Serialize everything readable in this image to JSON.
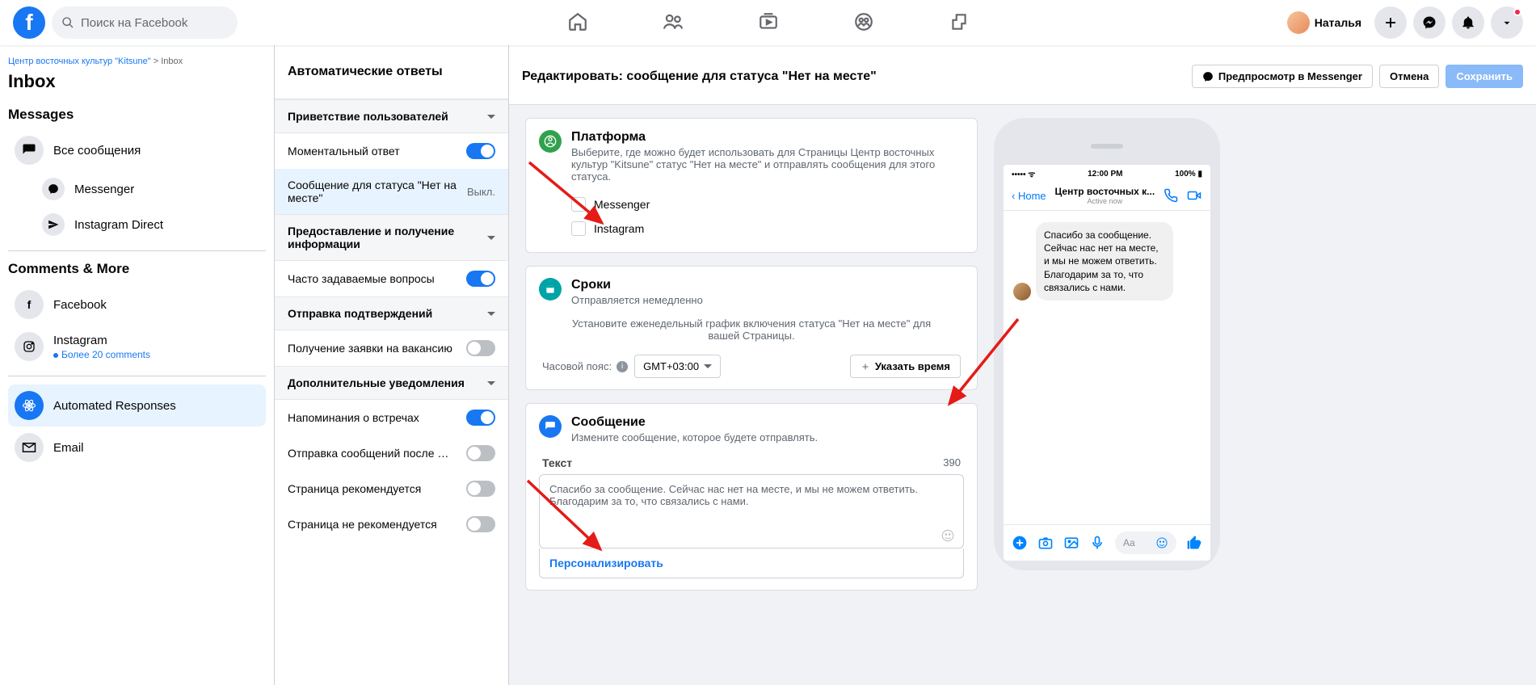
{
  "topnav": {
    "search_placeholder": "Поиск на Facebook",
    "user_name": "Наталья"
  },
  "sidebar_left": {
    "breadcrumb_page": "Центр восточных культур \"Kitsune\"",
    "breadcrumb_sep": ">",
    "breadcrumb_item": "Inbox",
    "title": "Inbox",
    "messages_label": "Messages",
    "all_messages": "Все сообщения",
    "messenger": "Messenger",
    "instagram_direct": "Instagram Direct",
    "comments_label": "Comments & More",
    "facebook": "Facebook",
    "instagram": "Instagram",
    "instagram_sub": "Более 20 comments",
    "automated": "Automated Responses",
    "email": "Email"
  },
  "col2": {
    "title": "Автоматические ответы",
    "groups": {
      "g1_title": "Приветствие пользователей",
      "g1_opt1": "Моментальный ответ",
      "g1_opt2": "Сообщение для статуса \"Нет на месте\"",
      "g1_opt2_status": "Выкл.",
      "g2_title": "Предоставление и получение информации",
      "g2_opt1": "Часто задаваемые вопросы",
      "g3_title": "Отправка подтверждений",
      "g3_opt1": "Получение заявки на вакансию",
      "g4_title": "Дополнительные уведомления",
      "g4_opt1": "Напоминания о встречах",
      "g4_opt2": "Отправка сообщений после назначени...",
      "g4_opt3": "Страница рекомендуется",
      "g4_opt4": "Страница не рекомендуется"
    }
  },
  "main": {
    "header_title": "Редактировать: сообщение для статуса \"Нет на месте\"",
    "preview_btn": "Предпросмотр в Messenger",
    "cancel_btn": "Отмена",
    "save_btn": "Сохранить",
    "platform": {
      "title": "Платформа",
      "desc": "Выберите, где можно будет использовать для Страницы Центр восточных культур \"Kitsune\" статус \"Нет на месте\" и отправлять сообщения для этого статуса.",
      "opt_messenger": "Messenger",
      "opt_instagram": "Instagram"
    },
    "schedule": {
      "title": "Сроки",
      "subtitle": "Отправляется немедленно",
      "desc": "Установите еженедельный график включения статуса \"Нет на месте\" для вашей Страницы.",
      "tz_label": "Часовой пояс:",
      "tz_value": "GMT+03:00",
      "add_time_btn": "Указать время"
    },
    "message": {
      "title": "Сообщение",
      "desc": "Измените сообщение, которое будете отправлять.",
      "text_label": "Текст",
      "char_count": "390",
      "content": "Спасибо за сообщение. Сейчас нас нет на месте, и мы не можем ответить. Благодарим за то, что связались с нами.",
      "personalize": "Персонализировать"
    }
  },
  "preview": {
    "time": "12:00 PM",
    "battery": "100%",
    "home": "Home",
    "title": "Центр восточных к...",
    "subtitle": "Active now",
    "bubble": "Спасибо за сообщение. Сейчас нас нет на месте, и мы не можем ответить. Благодарим за то, что связались с нами.",
    "input_placeholder": "Aa"
  }
}
